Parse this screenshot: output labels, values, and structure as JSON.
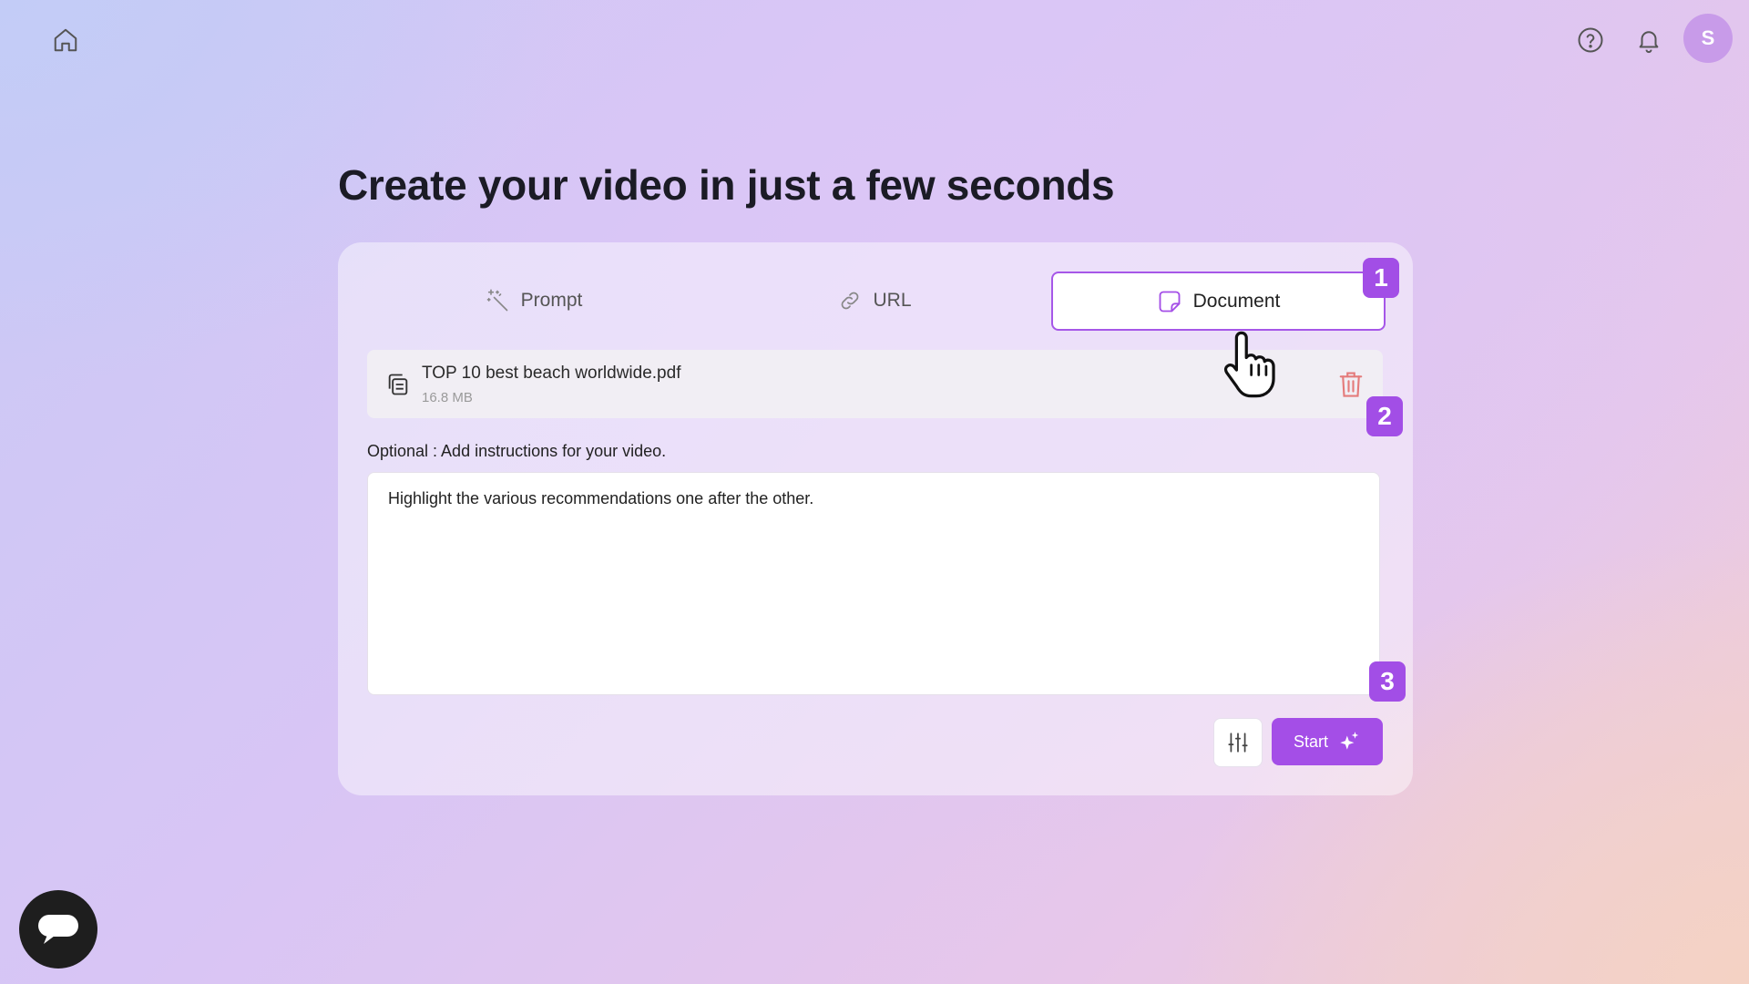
{
  "header": {
    "home_icon": "home-icon",
    "help_icon": "help-circle-icon",
    "bell_icon": "bell-icon",
    "avatar_initial": "S"
  },
  "main": {
    "title": "Create your video in just a few seconds",
    "tabs": [
      {
        "label": "Prompt",
        "icon": "magic-wand-icon"
      },
      {
        "label": "URL",
        "icon": "link-icon"
      },
      {
        "label": "Document",
        "icon": "document-icon",
        "active": true
      }
    ],
    "file": {
      "name": "TOP 10 best beach worldwide.pdf",
      "size": "16.8 MB",
      "icon": "file-copy-icon",
      "delete_icon": "trash-icon"
    },
    "optional_label": "Optional : Add instructions for your video.",
    "instructions_value": "Highlight the various recommendations one after the other.",
    "settings_icon": "sliders-icon",
    "start_label": "Start",
    "start_icon": "sparkles-icon"
  },
  "badges": [
    "1",
    "2",
    "3"
  ],
  "colors": {
    "accent": "#a44ee7",
    "trash": "#e47b7b",
    "avatar": "#c89be9"
  },
  "chat_icon": "chat-bubble-icon"
}
